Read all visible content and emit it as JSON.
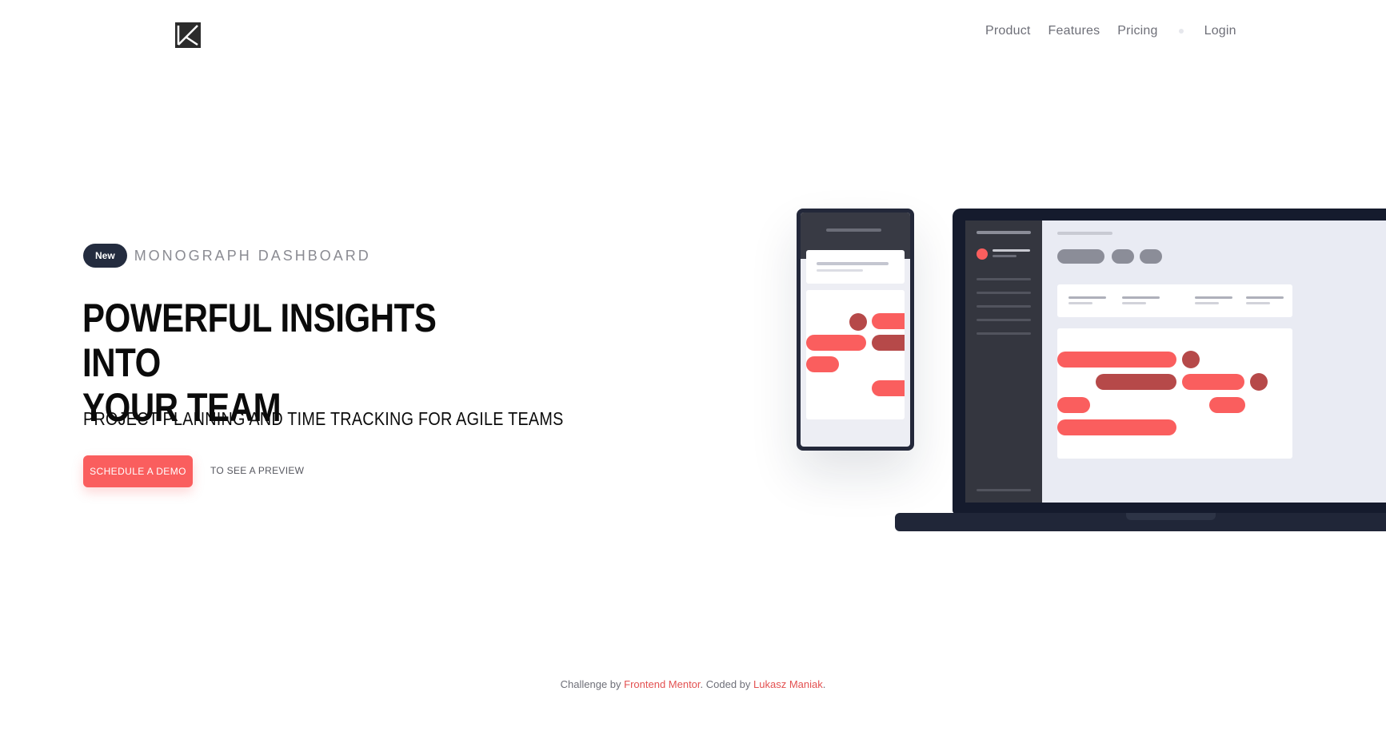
{
  "header": {
    "nav": [
      "Product",
      "Features",
      "Pricing"
    ],
    "login": "Login"
  },
  "hero": {
    "badge": "New",
    "eyebrow": "MONOGRAPH DASHBOARD",
    "headline_line1": "POWERFUL INSIGHTS INTO",
    "headline_line2": "YOUR TEAM",
    "subhead": "PROJECT PLANNING AND TIME TRACKING FOR AGILE TEAMS",
    "cta": "SCHEDULE A DEMO",
    "preview": "TO SEE A PREVIEW"
  },
  "footer": {
    "prefix": "Challenge by",
    "link1": "Frontend Mentor",
    "middle": ". Coded by",
    "link2": "Lukasz Maniak",
    "suffix": "."
  },
  "colors": {
    "accent": "#fa5e5e",
    "accent_dark": "#b64949",
    "navy": "#242c3f"
  },
  "icons": [
    "k-logo-icon"
  ]
}
